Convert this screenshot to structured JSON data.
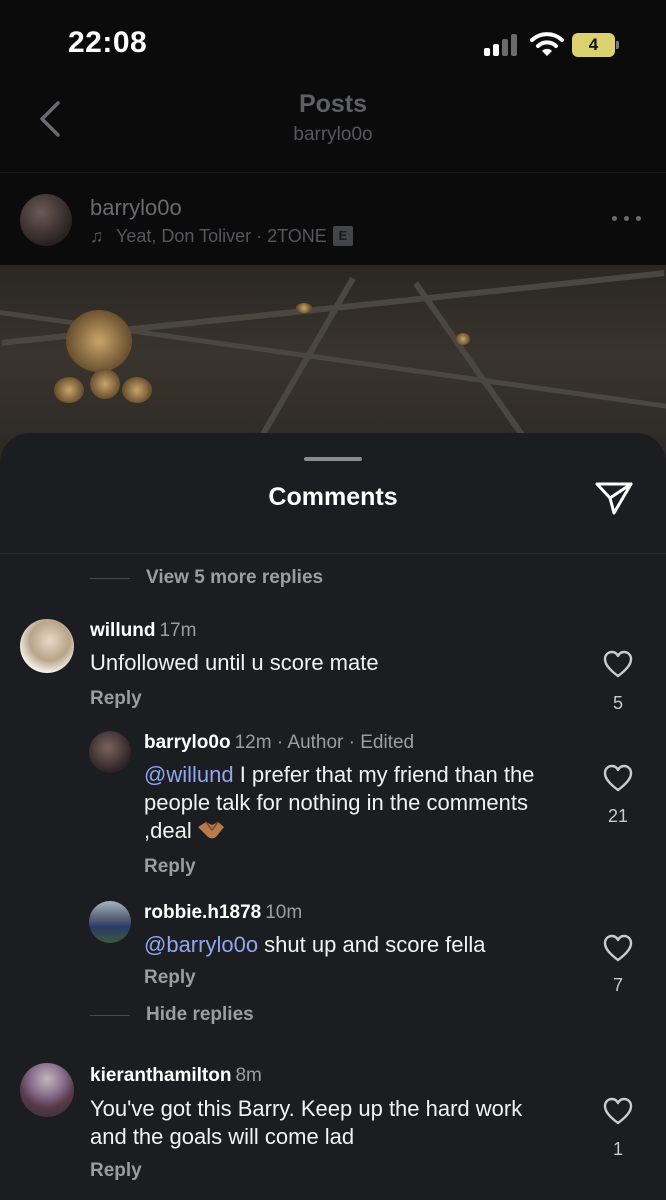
{
  "status_bar": {
    "time": "22:08",
    "battery": "4"
  },
  "posts_header": {
    "title": "Posts",
    "subtitle": "barrylo0o"
  },
  "post": {
    "username": "barrylo0o",
    "music": "Yeat, Don Toliver · 2TONE",
    "explicit_badge": "E"
  },
  "comments_sheet": {
    "title": "Comments",
    "view_more_replies": "View 5 more replies",
    "hide_replies": "Hide replies",
    "comments": [
      {
        "username": "willund",
        "meta": "17m",
        "text": "Unfollowed until u score mate",
        "reply_label": "Reply",
        "likes": "5"
      },
      {
        "username": "barrylo0o",
        "meta": "12m · Author · Edited",
        "mention": "@willund",
        "text": " I prefer that my friend than the people talk for nothing in the comments ,deal",
        "reply_label": "Reply",
        "likes": "21"
      },
      {
        "username": "robbie.h1878",
        "meta": "10m",
        "mention": "@barrylo0o",
        "text": " shut up and score fella",
        "reply_label": "Reply",
        "likes": "7"
      },
      {
        "username": "kieranthamilton",
        "meta": "8m",
        "text": "You've got this Barry. Keep up the hard work and the goals will come lad",
        "reply_label": "Reply",
        "likes": "1"
      }
    ]
  },
  "colors": {
    "sheet_bg": "#1c1d21",
    "mention": "#8fa7ee",
    "battery": "#d9d26e"
  }
}
